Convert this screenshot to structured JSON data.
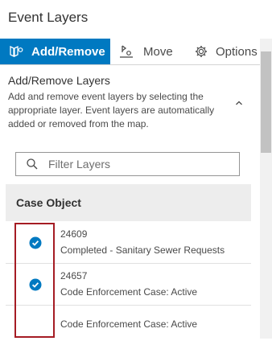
{
  "panel": {
    "title": "Event Layers"
  },
  "tabs": [
    {
      "label": "Add/Remove",
      "icon": "add-remove-layers-icon",
      "active": true
    },
    {
      "label": "Move",
      "icon": "move-icon",
      "active": false
    },
    {
      "label": "Options",
      "icon": "gear-icon",
      "active": false
    }
  ],
  "section": {
    "title": "Add/Remove Layers",
    "description": "Add and remove event layers by selecting the appropriate layer. Event layers are automatically added or removed from the map.",
    "collapse_icon": "chevron-up-icon"
  },
  "filter": {
    "placeholder": "Filter Layers",
    "value": ""
  },
  "group": {
    "title": "Case Object"
  },
  "layers": [
    {
      "id": "24609",
      "name": "Completed - Sanitary Sewer Requests",
      "checked": true
    },
    {
      "id": "24657",
      "name": "Code Enforcement Case: Active",
      "checked": true
    },
    {
      "id": "",
      "name": "Code Enforcement Case: Active",
      "checked": false
    }
  ],
  "colors": {
    "accent": "#0079c1",
    "highlight": "#a51c24",
    "group_bg": "#ededed"
  }
}
